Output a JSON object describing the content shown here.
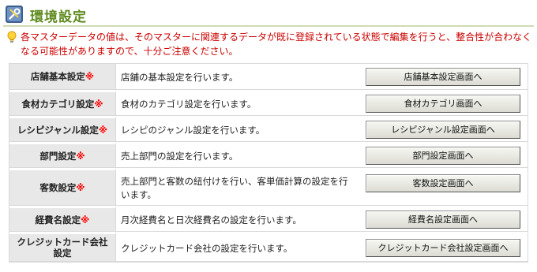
{
  "header": {
    "title": "環境設定",
    "icon": "settings-tools-icon"
  },
  "notice": {
    "icon": "lightbulb-icon",
    "text": "各マスターデータの値は、そのマスターに関連するデータが既に登録されている状態で編集を行うと、整合性が合わなくなる可能性がありますので、十分ご注意ください。"
  },
  "required_mark": "※",
  "rows": [
    {
      "label": "店舗基本設定",
      "required": "※",
      "desc": "店舗の基本設定を行います。",
      "button": "店舗基本設定画面へ"
    },
    {
      "label": "食材カテゴリ設定",
      "required": "※",
      "desc": "食材のカテゴリ設定を行います。",
      "button": "食材カテゴリ画面へ"
    },
    {
      "label": "レシピジャンル設定",
      "required": "※",
      "desc": "レシピのジャンル設定を行います。",
      "button": "レシピジャンル設定画面へ"
    },
    {
      "label": "部門設定",
      "required": "※",
      "desc": "売上部門の設定を行います。",
      "button": "部門設定画面へ"
    },
    {
      "label": "客数設定",
      "required": "※",
      "desc": "売上部門と客数の紐付けを行い、客単価計算の設定を行います。",
      "button": "客数設定画面へ"
    },
    {
      "label": "経費名設定",
      "required": "※",
      "desc": "月次経費名と日次経費名の設定を行います。",
      "button": "経費名設定画面へ"
    },
    {
      "label": "クレジットカード会社設定",
      "required": "",
      "desc": "クレジットカード会社の設定を行います。",
      "button": "クレジットカード会社設定画面へ"
    }
  ]
}
